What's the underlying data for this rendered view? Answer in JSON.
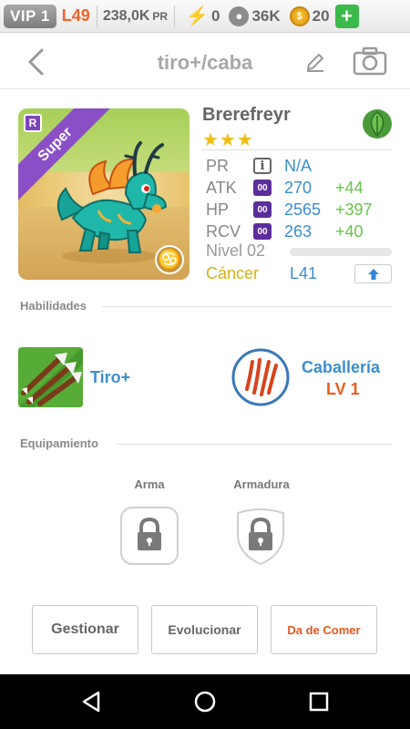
{
  "status_bar": {
    "vip": "VIP 1",
    "player_level": "L49",
    "power_value": "238,0K",
    "power_unit": "PR",
    "energy": "0",
    "paws": "36K",
    "coins": "20",
    "add_label": "+"
  },
  "header": {
    "title": "tiro+/caba"
  },
  "card": {
    "rarity_letter": "R",
    "ribbon": "Super",
    "zodiac_glyph": "♋"
  },
  "pet": {
    "name": "Brerefreyr",
    "stars": "★★★",
    "stats": [
      {
        "label": "PR",
        "badge": "i",
        "value": "N/A",
        "bonus": ""
      },
      {
        "label": "ATK",
        "badge": "00",
        "value": "270",
        "bonus": "+44"
      },
      {
        "label": "HP",
        "badge": "00",
        "value": "2565",
        "bonus": "+397"
      },
      {
        "label": "RCV",
        "badge": "00",
        "value": "263",
        "bonus": "+40"
      }
    ],
    "level_label": "Nivel 02",
    "xp_progress": 0.0,
    "sign": "Cáncer",
    "max_level": "L41"
  },
  "abilities": {
    "title": "Habilidades",
    "skill1": "Tiro+",
    "skill2": "Caballería",
    "skill2_level": "LV 1"
  },
  "equipment": {
    "title": "Equipamiento",
    "weapon_label": "Arma",
    "armor_label": "Armadura"
  },
  "actions": {
    "manage": "Gestionar",
    "evolve": "Evolucionar",
    "feed": "Da de Comer"
  },
  "colors": {
    "accent_blue": "#3a8fcf",
    "bonus_green": "#6ac24a",
    "orange": "#ef5a1c",
    "star_gold": "#f0bc12"
  }
}
